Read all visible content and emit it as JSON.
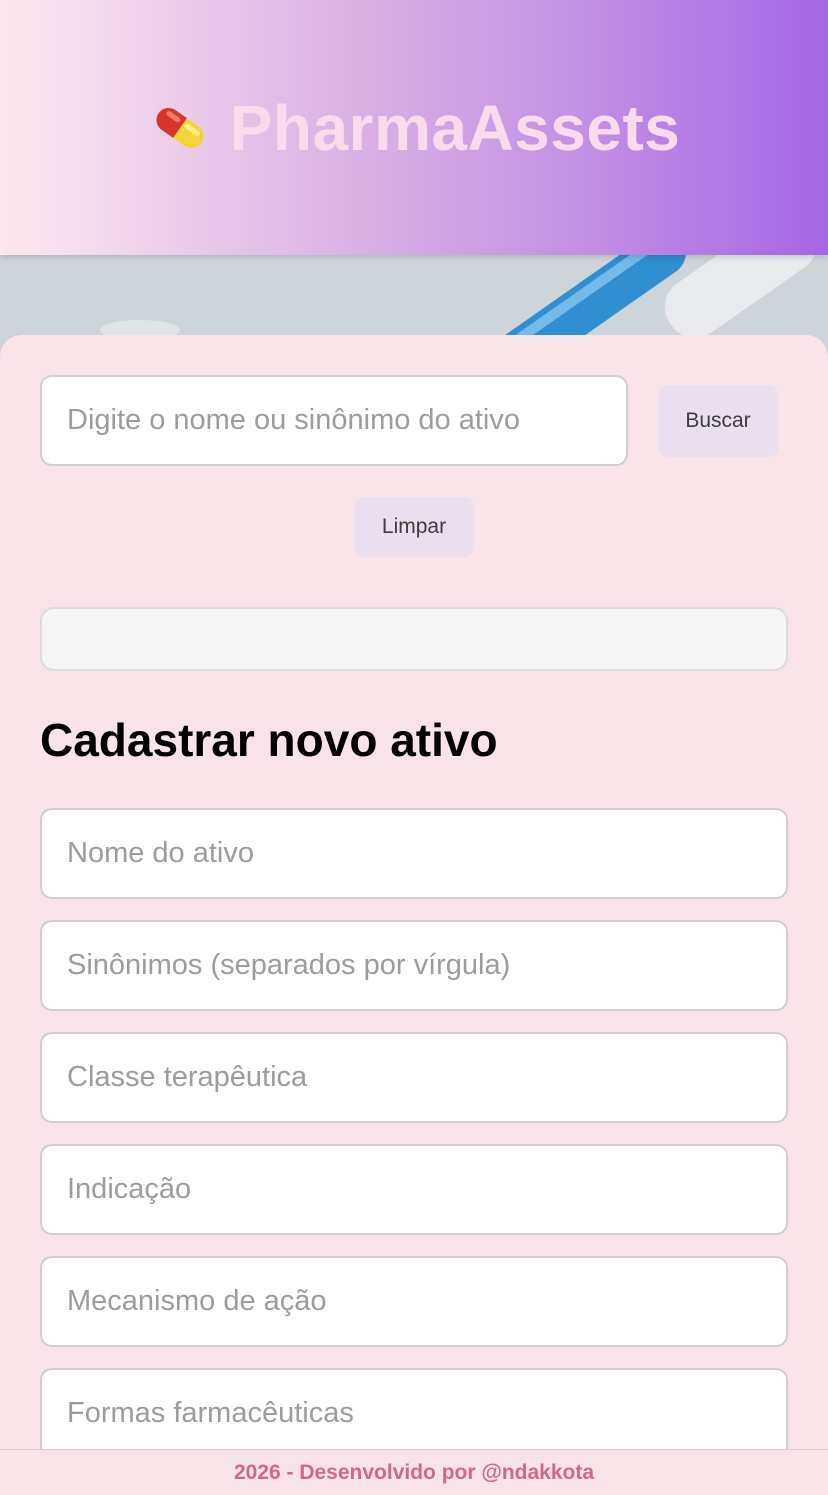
{
  "header": {
    "title": "PharmaAssets",
    "icon": "pill-icon"
  },
  "search": {
    "placeholder": "Digite o nome ou sinônimo do ativo",
    "value": "",
    "search_button": "Buscar",
    "clear_button": "Limpar",
    "result_text": ""
  },
  "form": {
    "title": "Cadastrar novo ativo",
    "fields": [
      {
        "placeholder": "Nome do ativo",
        "value": ""
      },
      {
        "placeholder": "Sinônimos (separados por vírgula)",
        "value": ""
      },
      {
        "placeholder": "Classe terapêutica",
        "value": ""
      },
      {
        "placeholder": "Indicação",
        "value": ""
      },
      {
        "placeholder": "Mecanismo de ação",
        "value": ""
      },
      {
        "placeholder": "Formas farmacêuticas",
        "value": ""
      }
    ]
  },
  "footer": {
    "text": "2026 - Desenvolvido por @ndakkota"
  },
  "colors": {
    "header_gradient_start": "#fbe6ec",
    "header_gradient_end": "#a566e4",
    "brand_text": "#f9dcec",
    "card_background": "#f8e3e8",
    "button_background": "#e9dfee",
    "footer_text": "#d2678c"
  }
}
